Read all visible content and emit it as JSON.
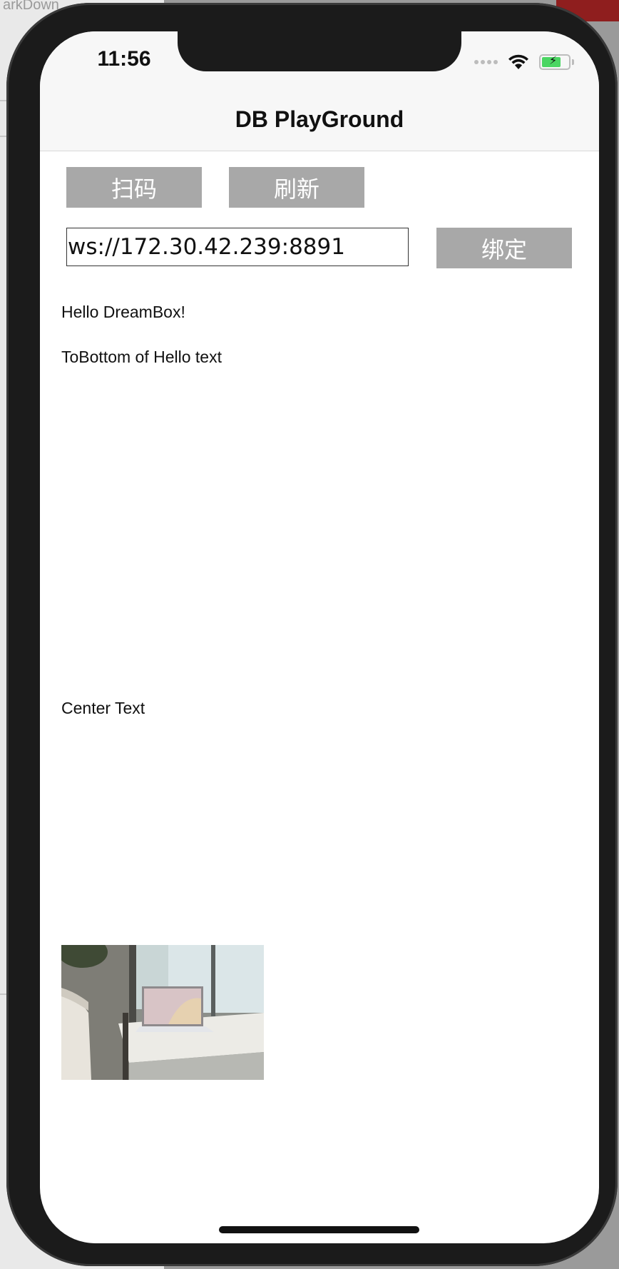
{
  "desktop": {
    "window_title_fragment": "arkDown"
  },
  "status_bar": {
    "time": "11:56",
    "battery_color": "#4bd663"
  },
  "nav": {
    "title": "DB PlayGround"
  },
  "buttons": {
    "scan": "扫码",
    "refresh": "刷新",
    "bind": "绑定"
  },
  "ws_input": {
    "value": "ws://172.30.42.239:8891"
  },
  "texts": {
    "hello": "Hello DreamBox!",
    "to_bottom": "ToBottom of Hello text",
    "center": "Center Text"
  },
  "image": {
    "icon": "photo-laptop-on-bench"
  },
  "colors": {
    "button_bg": "#a8a8a8",
    "button_text": "#ffffff"
  }
}
